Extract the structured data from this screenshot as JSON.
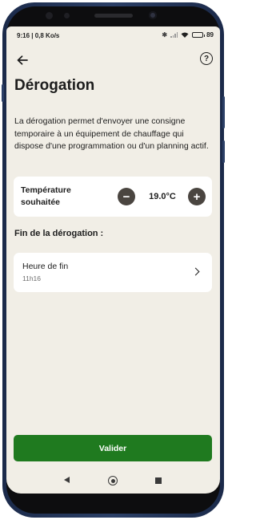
{
  "status_bar": {
    "time_speed": "9:16 | 0,8 Ko/s",
    "battery": "89",
    "battery_level": 0.89
  },
  "header": {
    "title": "Dérogation",
    "help_symbol": "?"
  },
  "description": "La dérogation permet d'envoyer une consigne temporaire à un équipement de chauffage qui dispose d'une programmation ou d'un planning actif.",
  "temperature": {
    "label": "Température souhaitée",
    "value": "19.0°C",
    "decrease_symbol": "−",
    "increase_symbol": "+"
  },
  "end_section": {
    "title": "Fin de la dérogation :",
    "item_label": "Heure de fin",
    "item_value": "11h16"
  },
  "actions": {
    "validate_label": "Valider"
  },
  "colors": {
    "background": "#f1eee6",
    "card": "#ffffff",
    "primary_button": "#1f7a1f",
    "round_button": "#4a4540",
    "text": "#1d1d1d",
    "secondary_text": "#6e6e6e"
  },
  "icons": {
    "back": "arrow-left-icon",
    "help": "question-circle-icon",
    "next": "chevron-right-icon"
  }
}
